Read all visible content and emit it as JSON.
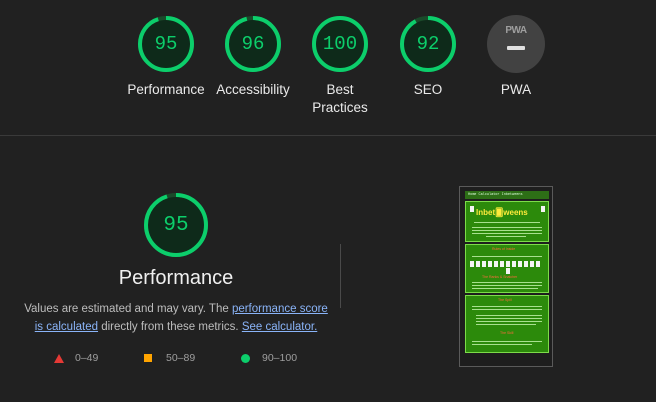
{
  "categories": [
    {
      "score": "95",
      "label": "Performance",
      "value": 0.95
    },
    {
      "score": "96",
      "label": "Accessibility",
      "value": 0.96
    },
    {
      "score": "100",
      "label": "Best Practices",
      "value": 1.0
    },
    {
      "score": "92",
      "label": "SEO",
      "value": 0.92
    }
  ],
  "pwa": {
    "badge_text": "PWA",
    "label": "PWA"
  },
  "detail": {
    "score": "95",
    "score_value": 0.95,
    "title": "Performance",
    "desc_prefix": "Values are estimated and may vary. The ",
    "link1": "performance score is calculated",
    "desc_middle": " directly from these metrics. ",
    "link2": "See calculator."
  },
  "legend": [
    {
      "range": "0–49",
      "symbol": "triangle",
      "color": "#e53935"
    },
    {
      "range": "50–89",
      "symbol": "square",
      "color": "#ffa400"
    },
    {
      "range": "90–100",
      "symbol": "circle",
      "color": "#0cce6b"
    }
  ],
  "thumbnail": {
    "nav_text": "Home  Calculator  Inbetweens",
    "logo_text": "Inbet🂠weens",
    "heading1": "Rules of Inside",
    "heading2": "The Ranks & Snatcher",
    "heading3": "The Spill",
    "heading4": "The Skill"
  },
  "colors": {
    "good": "#0cce6b",
    "average": "#ffa400",
    "fail": "#e53935"
  }
}
